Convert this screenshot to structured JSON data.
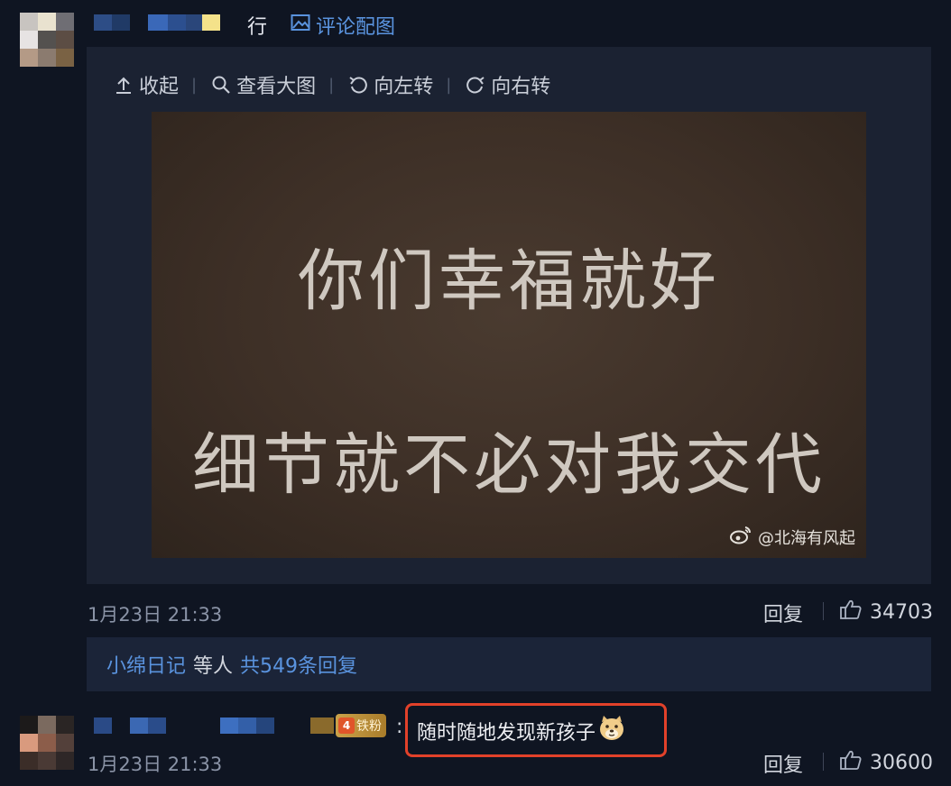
{
  "comment1": {
    "text_tail": "行",
    "image_link": "评论配图",
    "toolbar": {
      "collapse": "收起",
      "view_large": "查看大图",
      "rotate_left": "向左转",
      "rotate_right": "向右转"
    },
    "meme": {
      "line1": "你们幸福就好",
      "line2": "细节就不必对我交代",
      "watermark": "@北海有风起"
    },
    "timestamp": "1月23日 21:33",
    "reply_label": "回复",
    "likes": "34703",
    "replies": {
      "user": "小绵日记",
      "middle": "等人",
      "total": "共549条回复"
    }
  },
  "comment2": {
    "badge_level": "4",
    "badge_label": "铁粉",
    "colon": ":",
    "text": "随时随地发现新孩子",
    "timestamp": "1月23日 21:33",
    "reply_label": "回复",
    "likes": "30600"
  },
  "colors": {
    "background": "#0f1522",
    "panel": "#1b2232",
    "link": "#5a93de",
    "highlight": "#e2412a"
  }
}
